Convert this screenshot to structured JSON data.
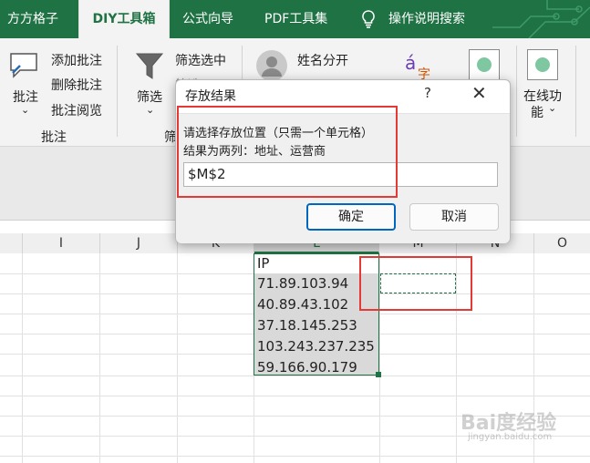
{
  "tabs": [
    "方方格子",
    "DIY工具箱",
    "公式向导",
    "PDF工具集",
    "操作说明搜索"
  ],
  "ribbon": {
    "annotate_big": "批注",
    "annotate_items": [
      "添加批注",
      "删除批注",
      "批注阅览"
    ],
    "annotate_group": "批注",
    "filter_big": "筛选",
    "filter_items": [
      "筛选选中"
    ],
    "filter_group_partial": "筛",
    "name_split": "姓名分开",
    "online_big": "在线功",
    "online_big2": "能"
  },
  "columns": [
    "I",
    "J",
    "K",
    "L",
    "M",
    "N",
    "O"
  ],
  "cells": {
    "header": "IP",
    "ips": [
      "71.89.103.94",
      "40.89.43.102",
      "37.18.145.253",
      "103.243.237.235",
      "59.166.90.179"
    ]
  },
  "dialog": {
    "title": "存放结果",
    "help": "?",
    "close": "✕",
    "line1": "请选择存放位置（只需一个单元格）",
    "line2": "结果为两列：地址、运营商",
    "input_value": "$M$2",
    "ok": "确定",
    "cancel": "取消"
  },
  "watermark": {
    "brand": "Bai度经验",
    "url": "jingyan.baidu.com"
  }
}
